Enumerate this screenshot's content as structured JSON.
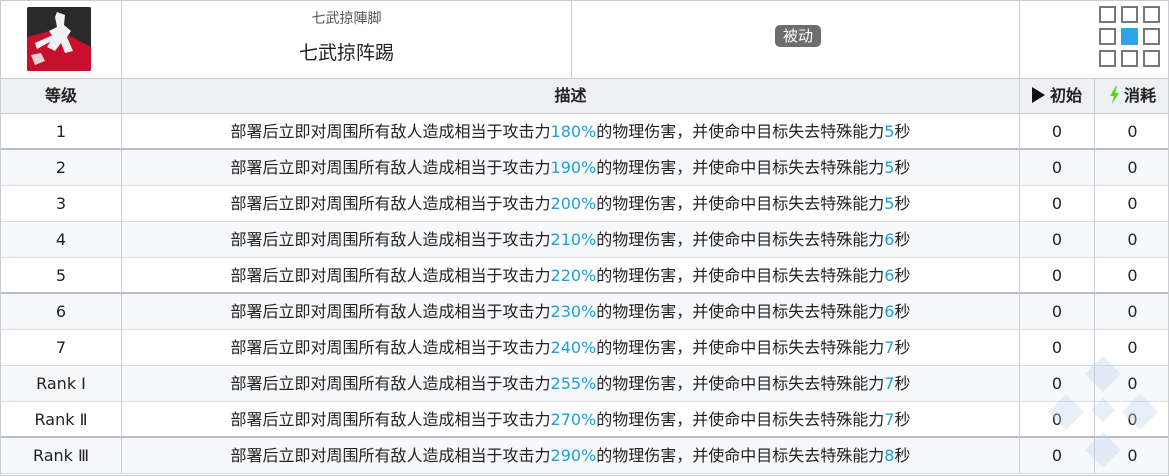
{
  "skill": {
    "icon": "skill-icon-female-fighter",
    "subtitle": "七武掠陣脚",
    "name": "七武掠阵踢",
    "type_badge": "被动",
    "range_icon": "range-grid-icon",
    "range_highlight": "center"
  },
  "table": {
    "headers": {
      "level": "等级",
      "description": "描述",
      "initial": "初始",
      "cost": "消耗"
    },
    "desc_parts": {
      "prefix": "部署后立即对周围所有敌人造成相当于攻击力",
      "middle": "的物理伤害，并使命中目标失去特殊能力",
      "suffix": "秒"
    },
    "rows": [
      {
        "level": "1",
        "pct": "180%",
        "sec": "5",
        "initial": "0",
        "cost": "0"
      },
      {
        "level": "2",
        "pct": "190%",
        "sec": "5",
        "initial": "0",
        "cost": "0"
      },
      {
        "level": "3",
        "pct": "200%",
        "sec": "5",
        "initial": "0",
        "cost": "0"
      },
      {
        "level": "4",
        "pct": "210%",
        "sec": "6",
        "initial": "0",
        "cost": "0"
      },
      {
        "level": "5",
        "pct": "220%",
        "sec": "6",
        "initial": "0",
        "cost": "0"
      },
      {
        "level": "6",
        "pct": "230%",
        "sec": "6",
        "initial": "0",
        "cost": "0"
      },
      {
        "level": "7",
        "pct": "240%",
        "sec": "7",
        "initial": "0",
        "cost": "0"
      },
      {
        "level": "Rank Ⅰ",
        "pct": "255%",
        "sec": "7",
        "initial": "0",
        "cost": "0"
      },
      {
        "level": "Rank Ⅱ",
        "pct": "270%",
        "sec": "7",
        "initial": "0",
        "cost": "0"
      },
      {
        "level": "Rank Ⅲ",
        "pct": "290%",
        "sec": "8",
        "initial": "0",
        "cost": "0"
      }
    ]
  },
  "colors": {
    "highlight": "#1e9fd8",
    "badge_bg": "#6e6e6e",
    "range_on": "#2fa3e6",
    "bolt": "#5bd21f"
  }
}
